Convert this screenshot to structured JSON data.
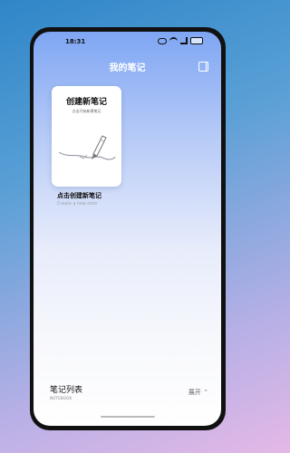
{
  "status_bar": {
    "time": "18:31"
  },
  "header": {
    "title": "我的笔记"
  },
  "card": {
    "cover_title": "创建新笔记",
    "cover_subtitle": "点击开始新建笔记",
    "name": "点击创建新笔记",
    "description": "Create a new note"
  },
  "notebook_list": {
    "title": "笔记列表",
    "subtitle": "NOTEBOOK",
    "expand_label": "展开 ⌃"
  },
  "icons": {
    "side": "sidebar-icon",
    "pen": "pen-illustration"
  },
  "colors": {
    "accent": "#7fa6f3"
  }
}
